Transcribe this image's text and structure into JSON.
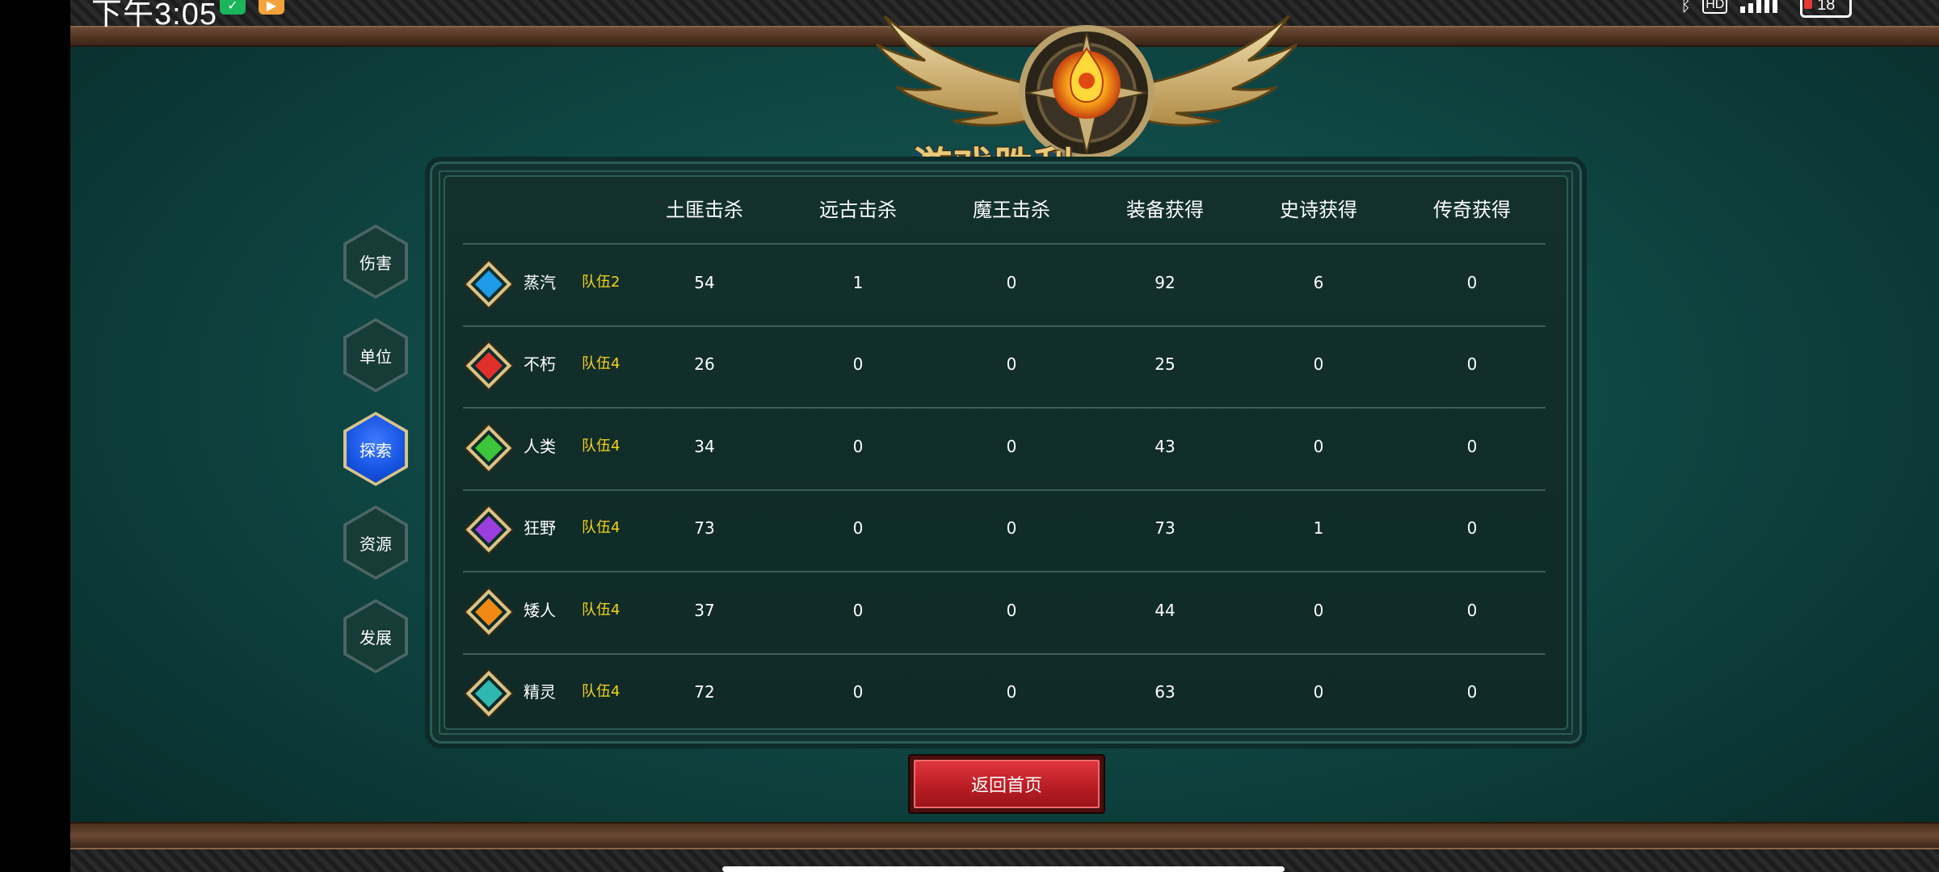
{
  "status_bar": {
    "time": "下午3:05",
    "battery": "18",
    "hd_label": "HD"
  },
  "banner": {
    "title": "游戏胜利"
  },
  "side_nav": [
    {
      "label": "伤害",
      "active": false
    },
    {
      "label": "单位",
      "active": false
    },
    {
      "label": "探索",
      "active": true
    },
    {
      "label": "资源",
      "active": false
    },
    {
      "label": "发展",
      "active": false
    }
  ],
  "table": {
    "columns": [
      "土匪击杀",
      "远古击杀",
      "魔王击杀",
      "装备获得",
      "史诗获得",
      "传奇获得"
    ],
    "rows": [
      {
        "race": "蒸汽",
        "team": "队伍2",
        "gem_color": "#1e9be8",
        "values": [
          "54",
          "1",
          "0",
          "92",
          "6",
          "0"
        ]
      },
      {
        "race": "不朽",
        "team": "队伍4",
        "gem_color": "#e0302c",
        "values": [
          "26",
          "0",
          "0",
          "25",
          "0",
          "0"
        ]
      },
      {
        "race": "人类",
        "team": "队伍4",
        "gem_color": "#3cc43a",
        "values": [
          "34",
          "0",
          "0",
          "43",
          "0",
          "0"
        ]
      },
      {
        "race": "狂野",
        "team": "队伍4",
        "gem_color": "#9b3ee0",
        "values": [
          "73",
          "0",
          "0",
          "73",
          "1",
          "0"
        ]
      },
      {
        "race": "矮人",
        "team": "队伍4",
        "gem_color": "#f08a12",
        "values": [
          "37",
          "0",
          "0",
          "44",
          "0",
          "0"
        ]
      },
      {
        "race": "精灵",
        "team": "队伍4",
        "gem_color": "#2fb8b0",
        "values": [
          "72",
          "0",
          "0",
          "63",
          "0",
          "0"
        ]
      }
    ]
  },
  "buttons": {
    "home": "返回首页"
  },
  "colors": {
    "team_text": "#f5d21c",
    "active_nav": "#1552e0",
    "home_button": "#c8242a"
  }
}
